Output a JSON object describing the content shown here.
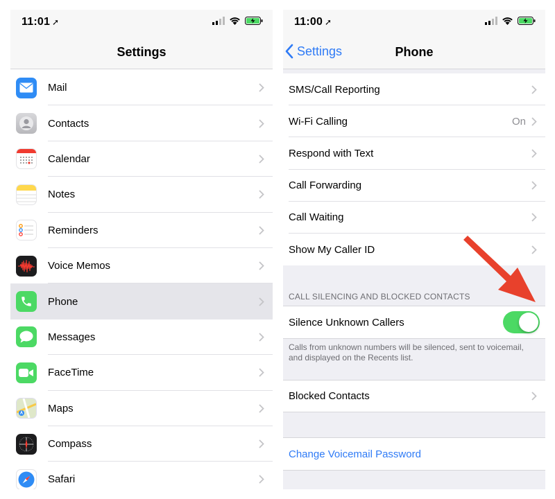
{
  "left": {
    "status": {
      "time": "11:01"
    },
    "nav": {
      "title": "Settings"
    },
    "items": [
      {
        "label": "Mail",
        "icon": "mail-icon",
        "color": "#2f8cf5"
      },
      {
        "label": "Contacts",
        "icon": "contacts-icon",
        "color": "#c9c9cc"
      },
      {
        "label": "Calendar",
        "icon": "calendar-icon",
        "color": "#ffffff"
      },
      {
        "label": "Notes",
        "icon": "notes-icon",
        "color": "#ffd84d"
      },
      {
        "label": "Reminders",
        "icon": "reminders-icon",
        "color": "#ffffff"
      },
      {
        "label": "Voice Memos",
        "icon": "voice-memos-icon",
        "color": "#1c1c1e"
      },
      {
        "label": "Phone",
        "icon": "phone-icon",
        "color": "#4cd964",
        "selected": true
      },
      {
        "label": "Messages",
        "icon": "messages-icon",
        "color": "#4cd964"
      },
      {
        "label": "FaceTime",
        "icon": "facetime-icon",
        "color": "#4cd964"
      },
      {
        "label": "Maps",
        "icon": "maps-icon",
        "color": "#e8eef3"
      },
      {
        "label": "Compass",
        "icon": "compass-icon",
        "color": "#1c1c1e"
      },
      {
        "label": "Safari",
        "icon": "safari-icon",
        "color": "#2f8cf5"
      }
    ]
  },
  "right": {
    "status": {
      "time": "11:00"
    },
    "nav": {
      "back_label": "Settings",
      "title": "Phone"
    },
    "group1": [
      {
        "label": "SMS/Call Reporting",
        "value": ""
      },
      {
        "label": "Wi-Fi Calling",
        "value": "On"
      },
      {
        "label": "Respond with Text",
        "value": ""
      },
      {
        "label": "Call Forwarding",
        "value": ""
      },
      {
        "label": "Call Waiting",
        "value": ""
      },
      {
        "label": "Show My Caller ID",
        "value": ""
      }
    ],
    "silencing": {
      "header": "CALL SILENCING AND BLOCKED CONTACTS",
      "toggle_label": "Silence Unknown Callers",
      "toggle_on": true,
      "note_line1": "Calls from unknown numbers will be silenced, sent to voicemail,",
      "note_line2": "and displayed on the Recents list."
    },
    "blocked": {
      "label": "Blocked Contacts"
    },
    "voicemail": {
      "label": "Change Voicemail Password"
    }
  },
  "colors": {
    "accent": "#2f7bf6",
    "toggle_on": "#4cd964",
    "arrow": "#e8412c",
    "battery": "#4cd964"
  }
}
